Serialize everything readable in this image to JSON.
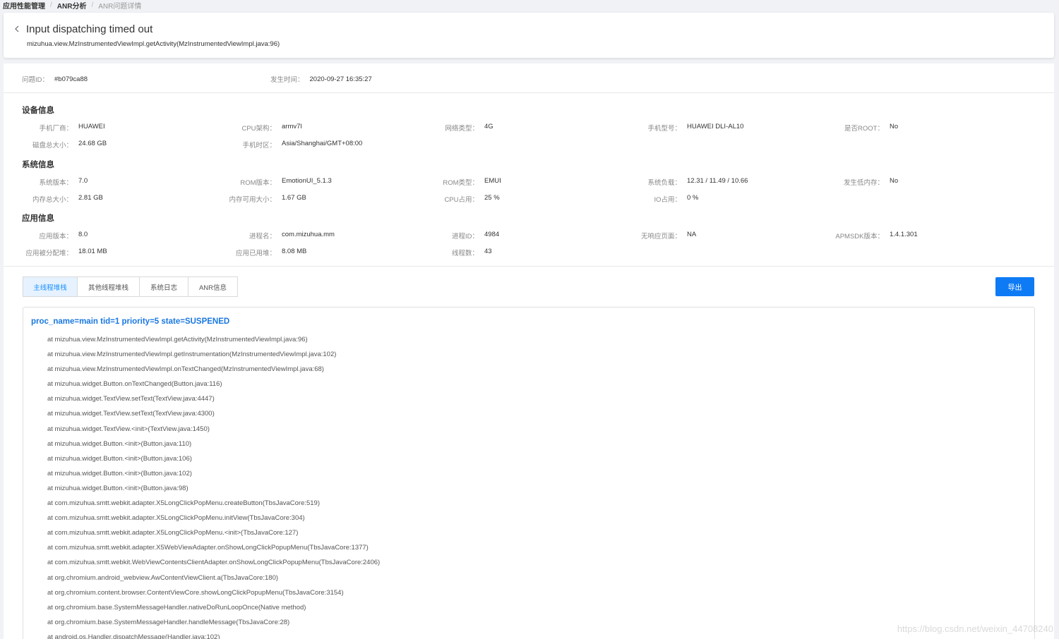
{
  "breadcrumb": [
    "应用性能管理",
    "ANR分析",
    "ANR问题详情"
  ],
  "header": {
    "title": "Input dispatching timed out",
    "subtitle": "mizuhua.view.MzInstrumentedViewImpl.getActivity(MzInstrumentedViewImpl.java:96)"
  },
  "issue": {
    "id_label": "问题ID：",
    "id_value": "#b079ca88",
    "time_label": "发生时间：",
    "time_value": "2020-09-27 16:35:27"
  },
  "device": {
    "title": "设备信息",
    "items": [
      {
        "k": "手机厂商：",
        "v": "HUAWEI"
      },
      {
        "k": "CPU架构：",
        "v": "armv7l"
      },
      {
        "k": "网络类型：",
        "v": "4G"
      },
      {
        "k": "手机型号：",
        "v": "HUAWEI DLI-AL10"
      },
      {
        "k": "是否ROOT：",
        "v": "No"
      },
      {
        "k": "磁盘总大小：",
        "v": "24.68 GB"
      },
      {
        "k": "手机时区：",
        "v": "Asia/Shanghai/GMT+08:00"
      }
    ]
  },
  "system": {
    "title": "系统信息",
    "items": [
      {
        "k": "系统版本：",
        "v": "7.0"
      },
      {
        "k": "ROM版本：",
        "v": "EmotionUI_5.1.3"
      },
      {
        "k": "ROM类型：",
        "v": "EMUI"
      },
      {
        "k": "系统负载：",
        "v": "12.31 / 11.49 / 10.66"
      },
      {
        "k": "发生低内存：",
        "v": "No"
      },
      {
        "k": "内存总大小：",
        "v": "2.81 GB"
      },
      {
        "k": "内存可用大小：",
        "v": "1.67 GB"
      },
      {
        "k": "CPU占用：",
        "v": "25 %"
      },
      {
        "k": "IO占用：",
        "v": "0 %"
      }
    ]
  },
  "app": {
    "title": "应用信息",
    "items": [
      {
        "k": "应用版本：",
        "v": "8.0"
      },
      {
        "k": "进程名：",
        "v": "com.mizuhua.mm"
      },
      {
        "k": "进程ID：",
        "v": "4984"
      },
      {
        "k": "无响应页面：",
        "v": "NA"
      },
      {
        "k": "APMSDK版本：",
        "v": "1.4.1.301"
      },
      {
        "k": "应用被分配堆：",
        "v": "18.01 MB"
      },
      {
        "k": "应用已用堆：",
        "v": "8.08 MB"
      },
      {
        "k": "线程数：",
        "v": "43"
      }
    ]
  },
  "tabs": [
    "主线程堆栈",
    "其他线程堆栈",
    "系统日志",
    "ANR信息"
  ],
  "export_label": "导出",
  "stack": {
    "header": "proc_name=main tid=1 priority=5 state=SUSPENED",
    "lines": [
      "at mizuhua.view.MzInstrumentedViewImpl.getActivity(MzInstrumentedViewImpl.java:96)",
      "at mizuhua.view.MzInstrumentedViewImpl.getInstrumentation(MzInstrumentedViewImpl.java:102)",
      "at mizuhua.view.MzInstrumentedViewImpl.onTextChanged(MzInstrumentedViewImpl.java:68)",
      "at mizuhua.widget.Button.onTextChanged(Button.java:116)",
      "at mizuhua.widget.TextView.setText(TextView.java:4447)",
      "at mizuhua.widget.TextView.setText(TextView.java:4300)",
      "at mizuhua.widget.TextView.<init>(TextView.java:1450)",
      "at mizuhua.widget.Button.<init>(Button.java:110)",
      "at mizuhua.widget.Button.<init>(Button.java:106)",
      "at mizuhua.widget.Button.<init>(Button.java:102)",
      "at mizuhua.widget.Button.<init>(Button.java:98)",
      "at com.mizuhua.smtt.webkit.adapter.X5LongClickPopMenu.createButton(TbsJavaCore:519)",
      "at com.mizuhua.smtt.webkit.adapter.X5LongClickPopMenu.initView(TbsJavaCore:304)",
      "at com.mizuhua.smtt.webkit.adapter.X5LongClickPopMenu.<init>(TbsJavaCore:127)",
      "at com.mizuhua.smtt.webkit.adapter.X5WebViewAdapter.onShowLongClickPopupMenu(TbsJavaCore:1377)",
      "at com.mizuhua.smtt.webkit.WebViewContentsClientAdapter.onShowLongClickPopupMenu(TbsJavaCore:2406)",
      "at org.chromium.android_webview.AwContentViewClient.a(TbsJavaCore:180)",
      "at org.chromium.content.browser.ContentViewCore.showLongClickPopupMenu(TbsJavaCore:3154)",
      "at org.chromium.base.SystemMessageHandler.nativeDoRunLoopOnce(Native method)",
      "at org.chromium.base.SystemMessageHandler.handleMessage(TbsJavaCore:28)",
      "at android.os.Handler.dispatchMessage(Handler.java:102)"
    ]
  },
  "watermark": "https://blog.csdn.net/weixin_44708240"
}
